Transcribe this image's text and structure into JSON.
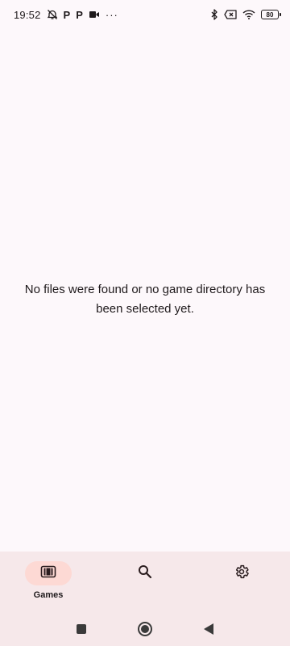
{
  "status_bar": {
    "time": "19:52",
    "p1": "P",
    "p2": "P",
    "overflow": "···",
    "battery": "80",
    "icons": [
      "alarm-off-icon",
      "video-camera-icon",
      "bluetooth-icon",
      "sim-x-icon",
      "wifi-icon",
      "battery-icon"
    ]
  },
  "main": {
    "empty_message": "No files were found or no game directory has been selected yet."
  },
  "bottom_nav": {
    "items": [
      {
        "label": "Games",
        "icon": "cartridge-icon",
        "active": true
      },
      {
        "label": "",
        "icon": "search-icon",
        "active": false
      },
      {
        "label": "",
        "icon": "gear-icon",
        "active": false
      }
    ]
  },
  "system_nav": {
    "buttons": [
      "recents-square-icon",
      "home-circle-icon",
      "back-triangle-icon"
    ]
  },
  "colors": {
    "background": "#fdf8fb",
    "nav_background": "#f6e8ea",
    "active_pill": "#fdd9d4",
    "text": "#1f1a1c"
  }
}
